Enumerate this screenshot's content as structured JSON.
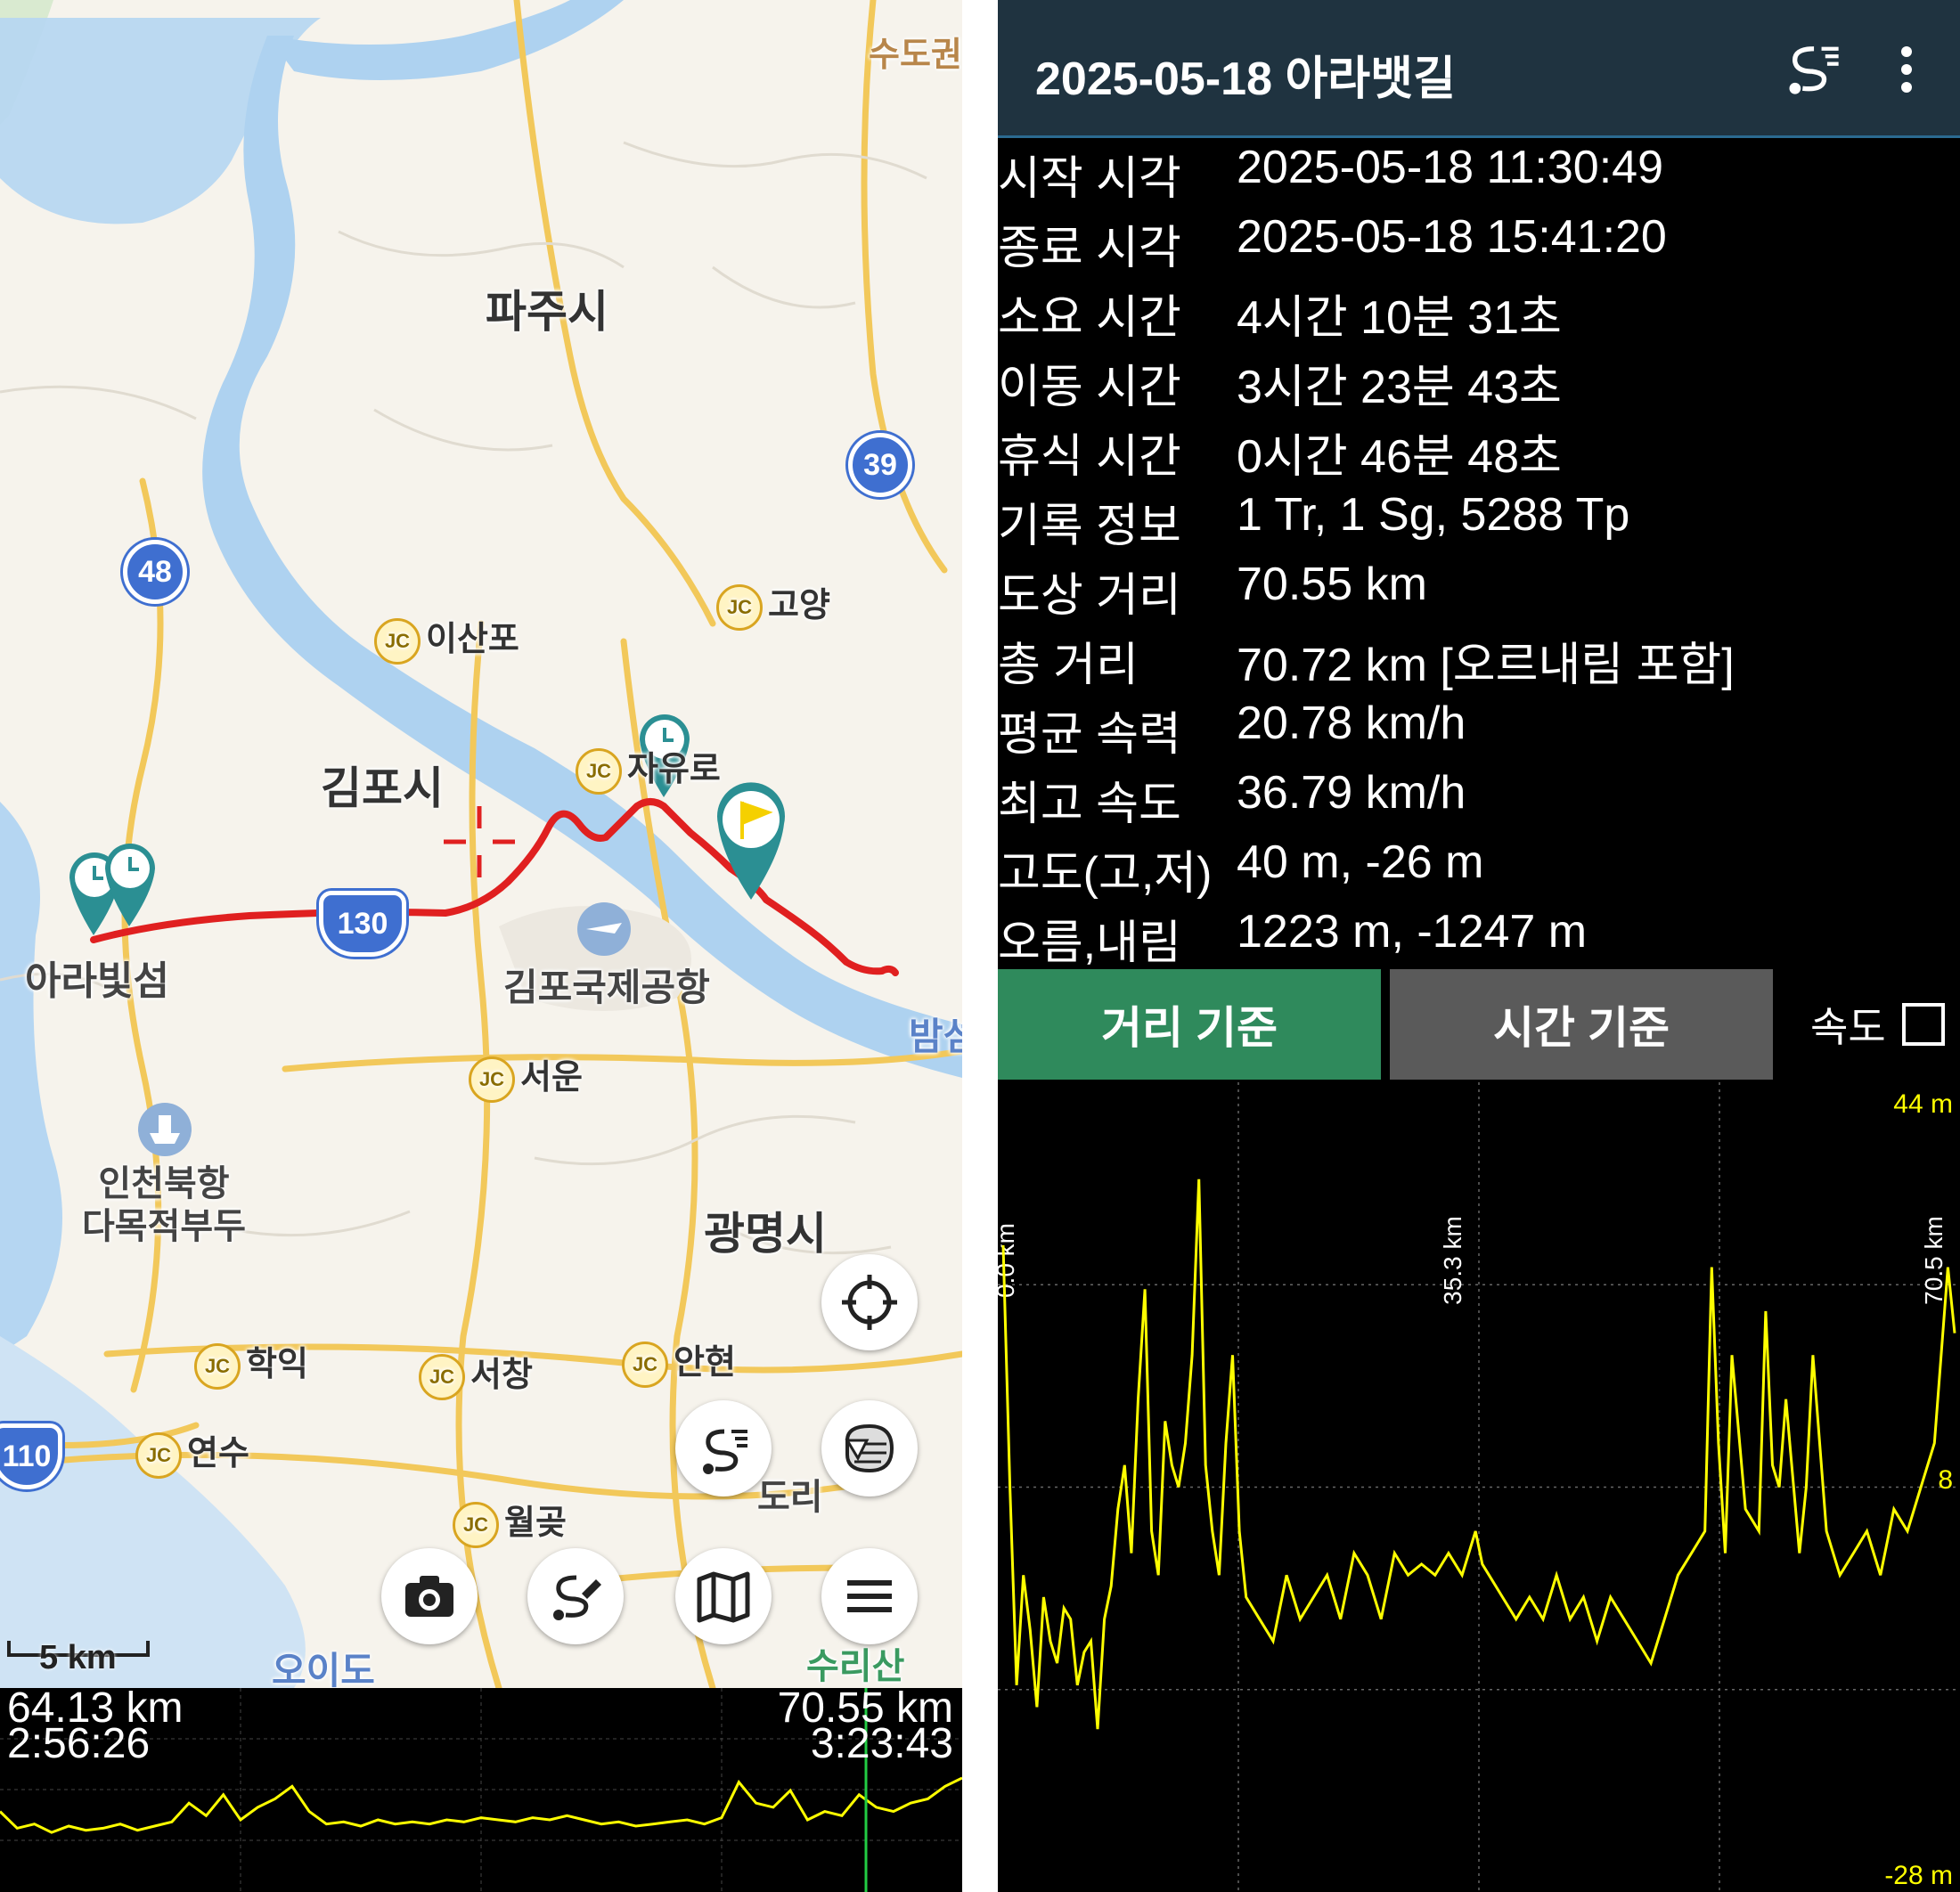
{
  "map": {
    "cities": [
      {
        "name": "파주시"
      },
      {
        "name": "김포시"
      },
      {
        "name": "광명시"
      }
    ],
    "places": {
      "capital_area": "수도권",
      "ara_island": "아라빛섬",
      "gimpo_airport": "김포국제공항",
      "incheon_port": "인천북항\n다목적부두",
      "oido": "오이도",
      "surisan": "수리산",
      "bam": "밤섬",
      "dori": "도리"
    },
    "junctions": [
      "이산포",
      "고양",
      "자유로",
      "서운",
      "학익",
      "서창",
      "안현",
      "연수",
      "월곶"
    ],
    "jc_badge": "JC",
    "routes": [
      "48",
      "39",
      "130",
      "110"
    ],
    "scale_label": "5 km",
    "icons": {
      "locate": "crosshair-icon",
      "layers": "layers-icon",
      "track": "route-icon",
      "camera": "camera-icon",
      "edit_track": "route-edit-icon",
      "map": "map-icon",
      "menu": "menu-icon",
      "clock_marker": "clock-marker-icon",
      "flag_marker": "flag-marker-icon",
      "cursor": "crosshair-cursor-icon"
    },
    "colors": {
      "track": "#e02020",
      "marker": "#2b8f93",
      "flag": "#f5d000"
    }
  },
  "mini_profile": {
    "left_distance": "64.13 km",
    "left_time": "2:56:26",
    "right_distance": "70.55 km",
    "right_time": "3:23:43"
  },
  "info": {
    "title": "2025-05-18 아라뱃길",
    "rows": [
      {
        "label": "시작 시각",
        "value": "2025-05-18 11:30:49"
      },
      {
        "label": "종료 시각",
        "value": "2025-05-18 15:41:20"
      },
      {
        "label": "소요 시간",
        "value": "4시간 10분 31초"
      },
      {
        "label": "이동 시간",
        "value": "3시간 23분 43초"
      },
      {
        "label": "휴식 시간",
        "value": "0시간 46분 48초"
      },
      {
        "label": "기록 정보",
        "value": "1 Tr, 1 Sg, 5288 Tp"
      },
      {
        "label": "도상 거리",
        "value": "70.55 km"
      },
      {
        "label": "총 거리",
        "value": "70.72 km [오르내림 포함]"
      },
      {
        "label": "평균 속력",
        "value": "20.78 km/h"
      },
      {
        "label": "최고 속도",
        "value": "36.79 km/h"
      },
      {
        "label": "고도(고,저)",
        "value": "40 m, -26 m"
      },
      {
        "label": "오름,내림",
        "value": "1223 m, -1247 m"
      }
    ],
    "tabs": {
      "distance": "거리 기준",
      "time": "시간 기준",
      "speed": "속도"
    },
    "speed_checked": false
  },
  "chart_data": {
    "type": "line",
    "x_ticks": [
      "0.0 km",
      "35.3 km",
      "70.5 km"
    ],
    "y_top_label": "44 m",
    "y_mid_label": "8",
    "y_bottom_label": "-28 m",
    "ylim": [
      -28,
      44
    ],
    "xlim": [
      0,
      70.5
    ],
    "color": "#ffff00",
    "series": [
      {
        "x": [
          0,
          0.5,
          1,
          1.5,
          2,
          2.5,
          3,
          3.5,
          4,
          4.5,
          5,
          5.5,
          6,
          6.5,
          7,
          7.5,
          8,
          8.5,
          9,
          9.5,
          10,
          10.5,
          11,
          11.5,
          12,
          12.5,
          13,
          13.5,
          14,
          14.5,
          15,
          15.5,
          16,
          16.5,
          17,
          17.5,
          18,
          19,
          20,
          21,
          22,
          23,
          24,
          25,
          26,
          27,
          28,
          29,
          30,
          31,
          32,
          33,
          34,
          35,
          35.5,
          36,
          37,
          38,
          39,
          40,
          41,
          42,
          43,
          44,
          45,
          46,
          47,
          48,
          49,
          50,
          51,
          52,
          52.5,
          53,
          53.5,
          54,
          55,
          56,
          56.5,
          57,
          57.5,
          58,
          59,
          59.5,
          60,
          61,
          62,
          63,
          64,
          65,
          66,
          67,
          68,
          69,
          70,
          70.5
        ],
        "y": [
          30,
          8,
          -10,
          0,
          -5,
          -12,
          -2,
          -6,
          -8,
          -3,
          -4,
          -10,
          -7,
          -6,
          -14,
          -4,
          -1,
          6,
          10,
          2,
          16,
          26,
          4,
          0,
          14,
          10,
          8,
          12,
          20,
          36,
          10,
          4,
          0,
          12,
          20,
          4,
          -2,
          -4,
          -6,
          0,
          -4,
          -2,
          0,
          -4,
          2,
          0,
          -4,
          2,
          0,
          1,
          0,
          2,
          0,
          4,
          1,
          0,
          -2,
          -4,
          -2,
          -4,
          0,
          -4,
          -2,
          -6,
          -2,
          -4,
          -6,
          -8,
          -4,
          0,
          2,
          4,
          28,
          12,
          2,
          20,
          6,
          4,
          24,
          10,
          8,
          16,
          2,
          8,
          20,
          4,
          0,
          2,
          4,
          0,
          6,
          4,
          8,
          12,
          28,
          22
        ]
      }
    ]
  },
  "mini_chart": {
    "color": "#ffff00",
    "y": [
      2,
      -6,
      -4,
      -8,
      -5,
      -7,
      -6,
      -4,
      -7,
      -5,
      -3,
      6,
      0,
      10,
      -2,
      4,
      8,
      14,
      2,
      -4,
      -3,
      -5,
      -2,
      -4,
      -3,
      -4,
      -2,
      -3,
      -1,
      -2,
      -3,
      -1,
      -2,
      0,
      -2,
      -4,
      -3,
      -5,
      -4,
      -3,
      -2,
      -4,
      -1,
      16,
      6,
      4,
      12,
      -2,
      2,
      0,
      10,
      4,
      2,
      6,
      8,
      14,
      18
    ],
    "cursor_fraction": 0.9
  }
}
